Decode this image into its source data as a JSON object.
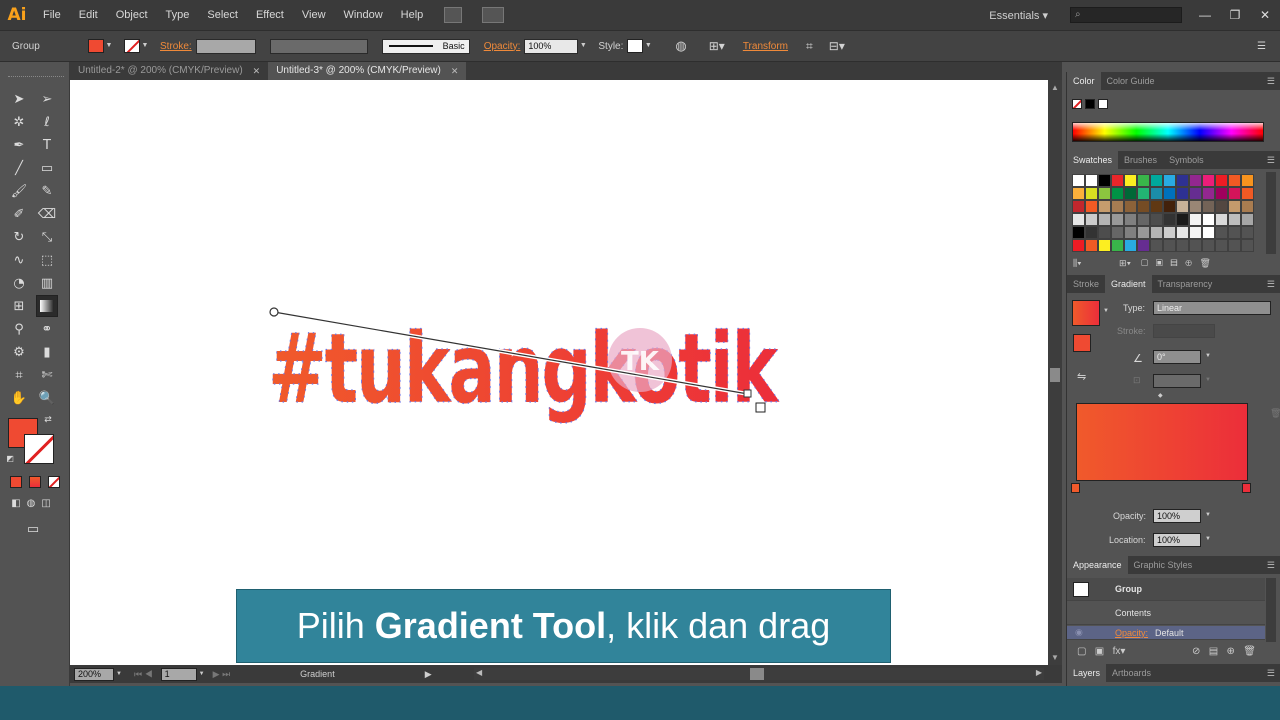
{
  "app": {
    "logo": "Ai"
  },
  "menu": [
    "File",
    "Edit",
    "Object",
    "Type",
    "Select",
    "Effect",
    "View",
    "Window",
    "Help"
  ],
  "workspace": {
    "label": "Essentials",
    "search_placeholder": ""
  },
  "control_bar": {
    "selection_label": "Group",
    "stroke_label": "Stroke:",
    "stroke_profile": "Basic",
    "opacity_label": "Opacity:",
    "opacity_value": "100%",
    "style_label": "Style:",
    "transform_label": "Transform",
    "fill_color": "#ef4a32"
  },
  "tabs": [
    {
      "label": "Untitled-2* @ 200% (CMYK/Preview)",
      "active": false
    },
    {
      "label": "Untitled-3* @ 200% (CMYK/Preview)",
      "active": true
    }
  ],
  "artwork": {
    "text": "#tukangkotik",
    "watermark": "TK",
    "gradient_start": "#f05a2b",
    "gradient_end": "#ec2e3a"
  },
  "caption": {
    "prefix": "Pilih ",
    "bold": "Gradient Tool",
    "suffix": ", klik dan drag"
  },
  "status_bar": {
    "zoom": "200%",
    "page": "1",
    "tool": "Gradient"
  },
  "panels": {
    "color_tabs": [
      "Color",
      "Color Guide"
    ],
    "swatches_tabs": [
      "Swatches",
      "Brushes",
      "Symbols"
    ],
    "gradient_tabs": [
      "Stroke",
      "Gradient",
      "Transparency"
    ],
    "gradient": {
      "type_label": "Type:",
      "type_value": "Linear",
      "stroke_label": "Stroke:",
      "angle_value": "0°",
      "opacity_label": "Opacity:",
      "opacity_value": "100%",
      "location_label": "Location:",
      "location_value": "100%"
    },
    "appearance_tabs": [
      "Appearance",
      "Graphic Styles"
    ],
    "appearance": {
      "group": "Group",
      "contents": "Contents",
      "opacity_label": "Opacity:",
      "opacity_value": "Default"
    },
    "bottom_tabs": [
      "Layers",
      "Artboards"
    ]
  }
}
